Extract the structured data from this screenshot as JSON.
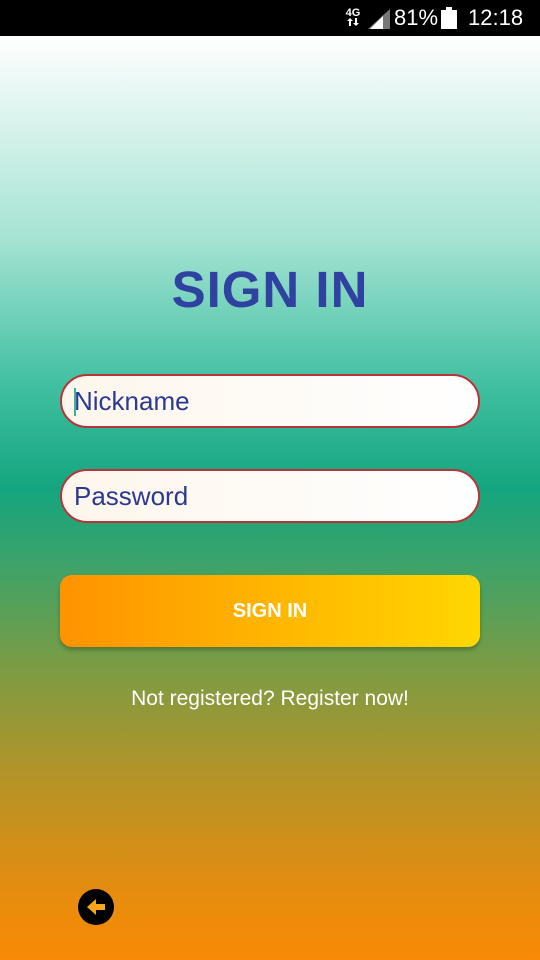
{
  "status_bar": {
    "network_type": "4G",
    "battery_percent": "81%",
    "time": "12:18",
    "icons": [
      "data-transfer-icon",
      "signal-icon",
      "battery-icon"
    ]
  },
  "login": {
    "title": "SIGN IN",
    "nickname": {
      "placeholder": "Nickname",
      "value": ""
    },
    "password": {
      "placeholder": "Password",
      "value": ""
    },
    "submit_label": "SIGN IN",
    "register_link": "Not registered? Register now!"
  },
  "navigation": {
    "back_icon": "back-arrow-icon"
  },
  "colors": {
    "title": "#2f42a0",
    "field_border": "#b9343a",
    "field_text": "#2b3990",
    "button_start": "#ff9300",
    "button_end": "#ffd700",
    "bg_top": "#ffffff",
    "bg_mid": "#14a57e",
    "bg_bottom": "#f98a05"
  }
}
